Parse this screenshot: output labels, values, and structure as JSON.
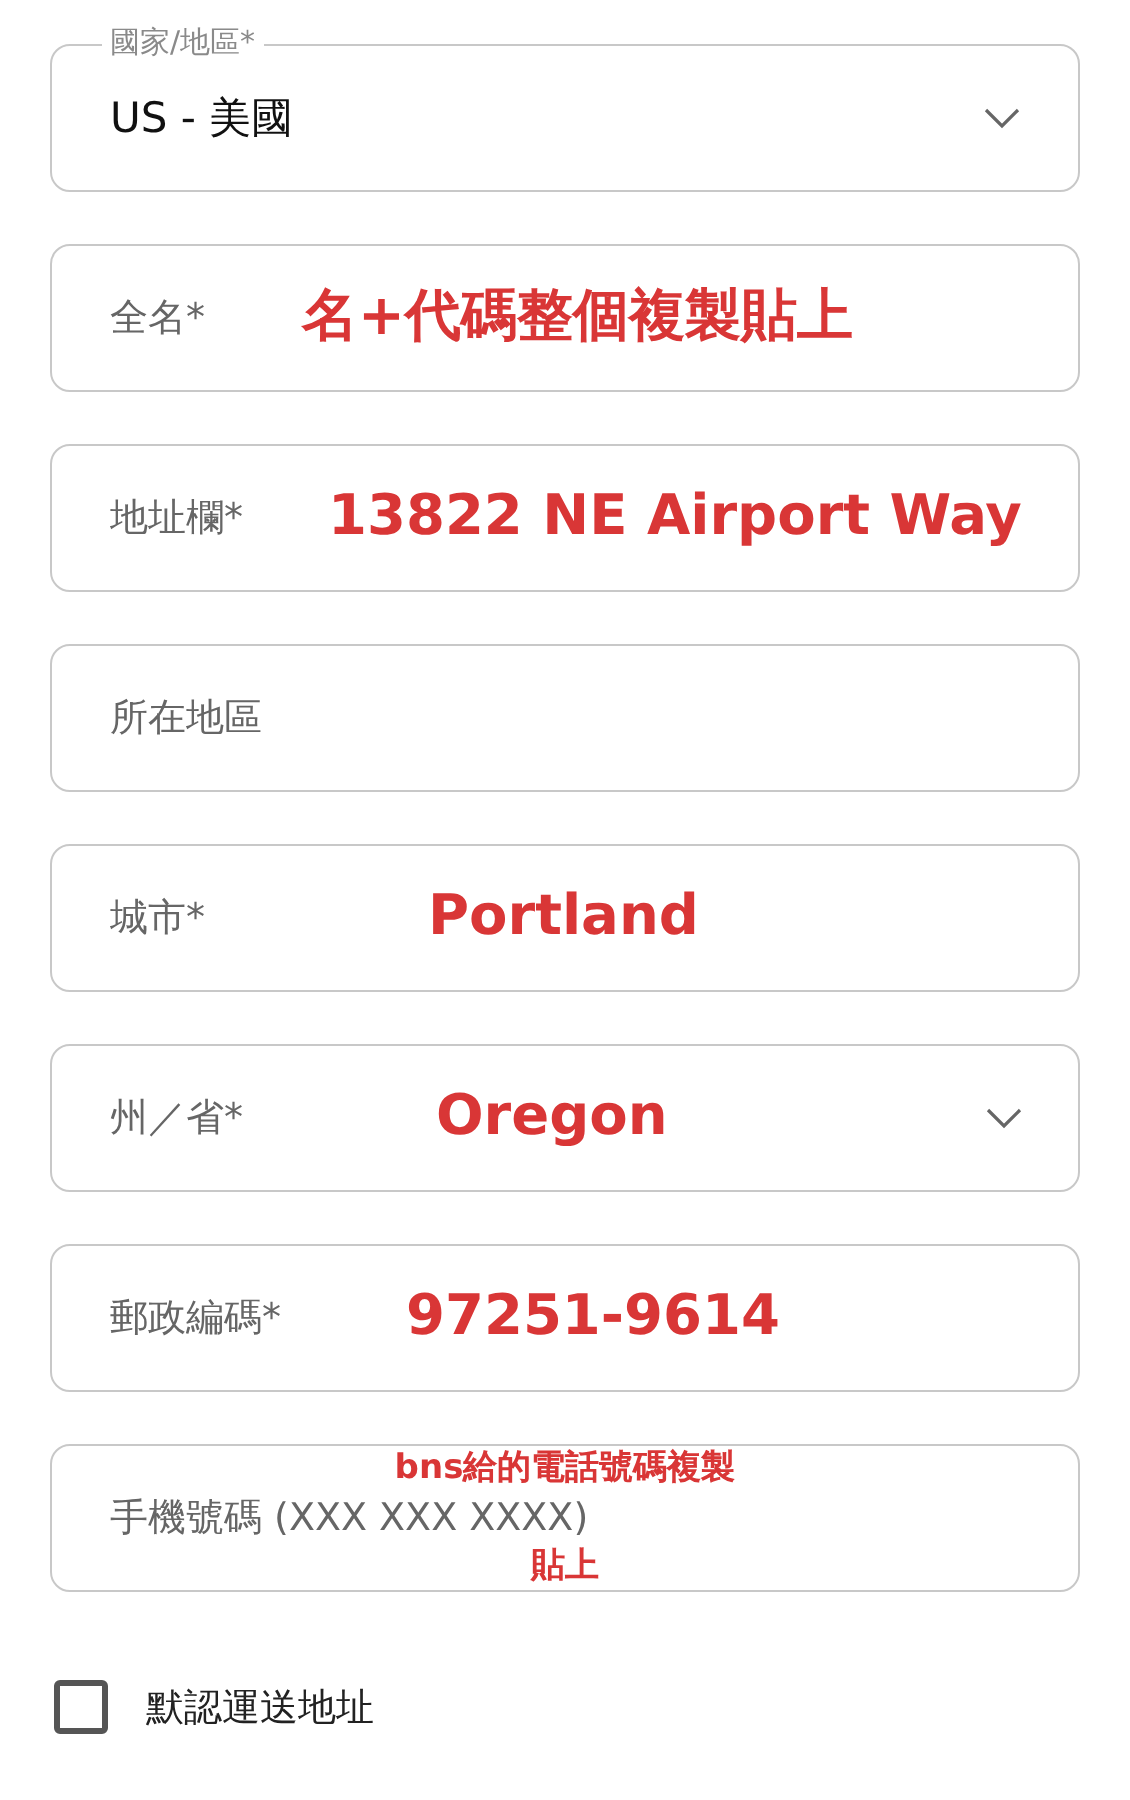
{
  "country": {
    "label": "國家/地區*",
    "value": "US - 美國"
  },
  "fields": [
    {
      "kind": "text",
      "placeholder": "全名*",
      "note": "名+代碼整個複製貼上"
    },
    {
      "kind": "text",
      "placeholder": "地址欄*",
      "note": "13822 NE Airport Way"
    },
    {
      "kind": "text",
      "placeholder": "所在地區"
    },
    {
      "kind": "text",
      "placeholder": "城市*",
      "note": "Portland"
    },
    {
      "kind": "select",
      "placeholder": "州／省*",
      "note": "Oregon"
    },
    {
      "kind": "text",
      "placeholder": "郵政編碼*",
      "note": "97251-9614"
    },
    {
      "kind": "text",
      "placeholder": "手機號碼 (XXX XXX XXXX)",
      "note_lines": [
        "bns給的電話號碼複製",
        "貼上"
      ]
    }
  ],
  "default_address": {
    "label": "默認運送地址",
    "checked": false
  }
}
